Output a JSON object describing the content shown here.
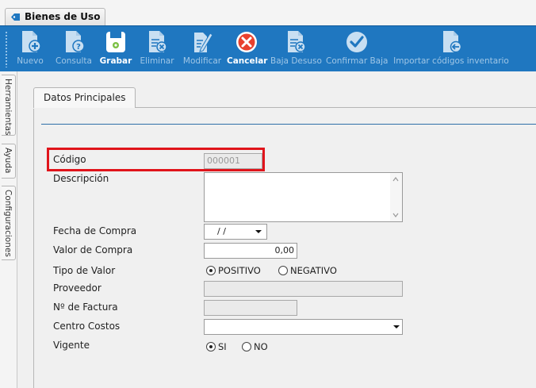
{
  "window": {
    "tab_title": "Bienes de Uso"
  },
  "toolbar": {
    "buttons": [
      {
        "label": "Nuevo",
        "icon": "new-doc-icon",
        "enabled": false
      },
      {
        "label": "Consulta",
        "icon": "query-doc-icon",
        "enabled": false
      },
      {
        "label": "Grabar",
        "icon": "save-icon",
        "enabled": true
      },
      {
        "label": "Eliminar",
        "icon": "delete-doc-icon",
        "enabled": false
      },
      {
        "label": "Modificar",
        "icon": "edit-doc-icon",
        "enabled": false
      },
      {
        "label": "Cancelar",
        "icon": "cancel-icon",
        "enabled": true
      },
      {
        "label": "Baja Desuso",
        "icon": "retire-doc-icon",
        "enabled": false
      },
      {
        "label": "Confirmar Baja",
        "icon": "confirm-check-icon",
        "enabled": false
      },
      {
        "label": "Importar códigos inventario",
        "icon": "import-doc-icon",
        "enabled": false
      }
    ]
  },
  "side_tabs": [
    "Herramientas",
    "Ayuda",
    "Configuraciones"
  ],
  "section": {
    "tab_label": "Datos Principales"
  },
  "form": {
    "codigo": {
      "label": "Código",
      "value": "000001"
    },
    "descripcion": {
      "label": "Descripción",
      "value": ""
    },
    "fecha_compra": {
      "label": "Fecha de Compra",
      "value": " /  /"
    },
    "valor_compra": {
      "label": "Valor de Compra",
      "value": "0,00"
    },
    "tipo_valor": {
      "label": "Tipo de Valor",
      "options": [
        "POSITIVO",
        "NEGATIVO"
      ],
      "selected": "POSITIVO"
    },
    "proveedor": {
      "label": "Proveedor",
      "value": ""
    },
    "nro_factura": {
      "label": "Nº de Factura",
      "value": ""
    },
    "centro_costos": {
      "label": "Centro Costos",
      "value": ""
    },
    "vigente": {
      "label": "Vigente",
      "options": [
        "SI",
        "NO"
      ],
      "selected": "SI"
    }
  },
  "colors": {
    "toolbar_bg": "#1f77c0",
    "highlight_border": "#e0141b",
    "accent_line": "#2f6fa8"
  }
}
